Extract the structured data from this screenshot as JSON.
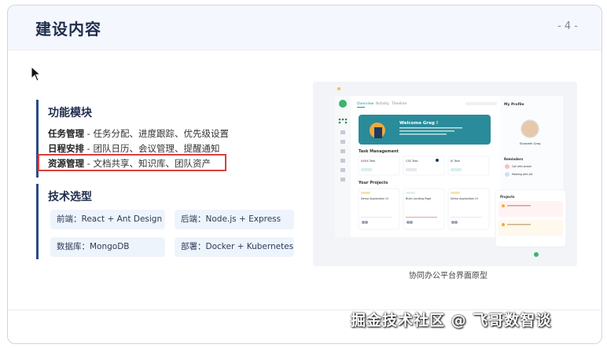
{
  "header": {
    "title": "建设内容",
    "page_number": "- 4 -"
  },
  "features": {
    "heading": "功能模块",
    "items": [
      {
        "name": "任务管理",
        "desc": " - 任务分配、进度跟踪、优先级设置"
      },
      {
        "name": "日程安排",
        "desc": " - 团队日历、会议管理、提醒通知"
      },
      {
        "name": "资源管理",
        "desc": " - 文档共享、知识库、团队资产"
      }
    ]
  },
  "tech": {
    "heading": "技术选型",
    "items": [
      "前端：React + Ant Design",
      "后端：Node.js + Express",
      "数据库：MongoDB",
      "部署：Docker + Kubernetes"
    ]
  },
  "screenshot": {
    "caption": "协同办公平台界面原型",
    "tabs": [
      "Overview",
      "Activity",
      "Timeline"
    ],
    "welcome": "Welcome Greg !",
    "task_management": "Task Management",
    "task_cards": [
      "UI/UX Task",
      "CSS Task",
      "JS Task"
    ],
    "your_projects": "Your Projects",
    "project_cards": [
      "Demo Application UI",
      "Build Landing Page",
      "Demo Application UI"
    ],
    "my_profile": "My Profile",
    "profile_name": "Elizabeth Greg",
    "reminders": "Reminders",
    "reminder_items": [
      "Call with Jensen",
      "Meeting with AD"
    ],
    "projects": "Projects",
    "colors": {
      "teal": "#2a8b9a",
      "green": "#3cb371",
      "dark": "#1f3a5f"
    }
  },
  "watermark": "掘金技术社区 @ 飞哥数智谈"
}
